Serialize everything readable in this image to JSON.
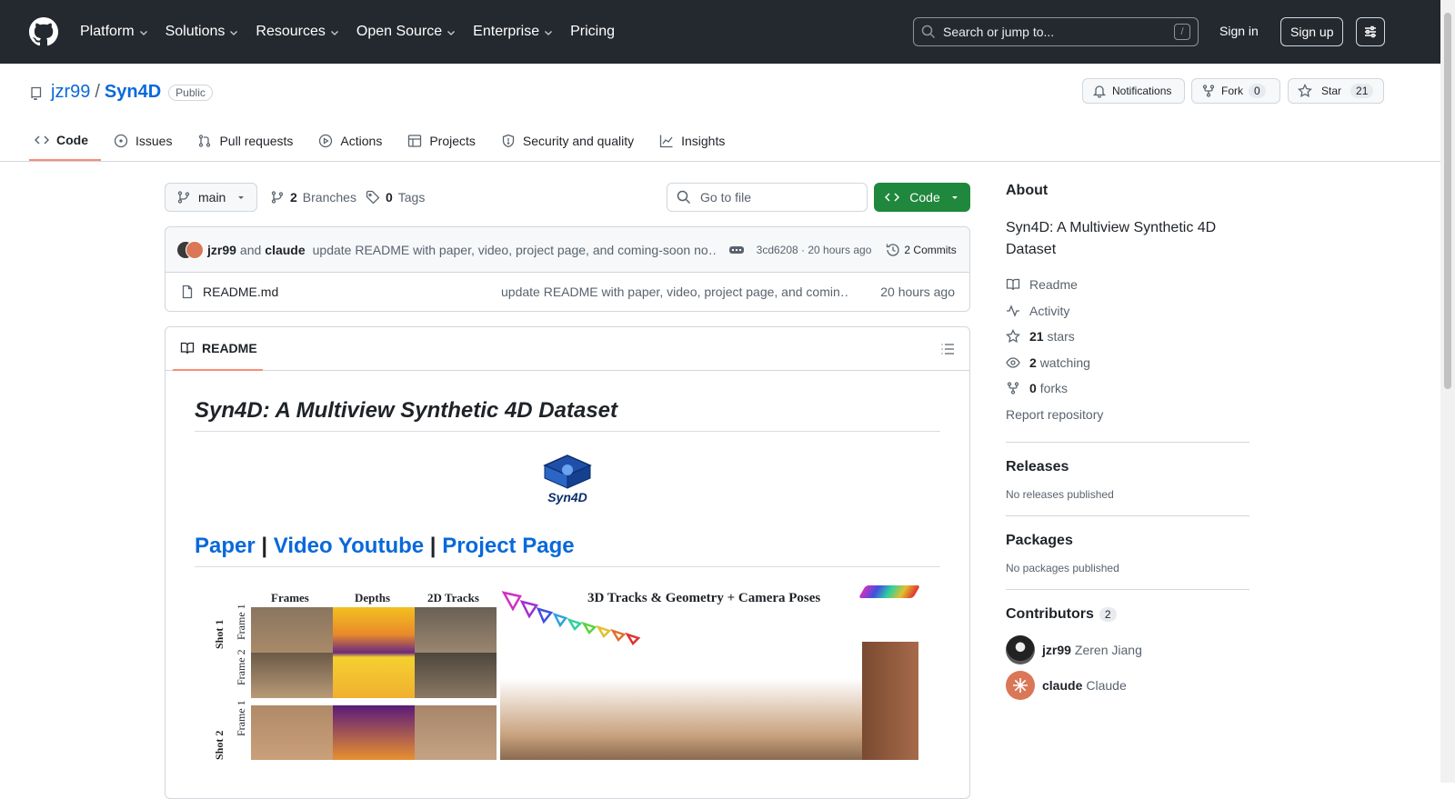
{
  "header": {
    "nav": [
      "Platform",
      "Solutions",
      "Resources",
      "Open Source",
      "Enterprise",
      "Pricing"
    ],
    "search_placeholder": "Search or jump to...",
    "slash": "/",
    "signin": "Sign in",
    "signup": "Sign up"
  },
  "repo": {
    "owner": "jzr99",
    "sep": "/",
    "name": "Syn4D",
    "visibility": "Public",
    "notifications": "Notifications",
    "fork": "Fork",
    "fork_count": "0",
    "star": "Star",
    "star_count": "21"
  },
  "tabs": [
    "Code",
    "Issues",
    "Pull requests",
    "Actions",
    "Projects",
    "Security and quality",
    "Insights"
  ],
  "bar": {
    "branch": "main",
    "branches_count": "2",
    "branches_label": "Branches",
    "tags_count": "0",
    "tags_label": "Tags",
    "gofile": "Go to file",
    "code": "Code"
  },
  "commit": {
    "author1": "jzr99",
    "and": "and",
    "author2": "claude",
    "message": "update README with paper, video, project page, and coming-soon no…",
    "hash": "3cd6208 · 20 hours ago",
    "commits": "2 Commits"
  },
  "files": [
    {
      "name": "README.md",
      "message": "update README with paper, video, project page, and comin…",
      "time": "20 hours ago"
    }
  ],
  "readme": {
    "tab": "README",
    "title": "Syn4D: A Multiview Synthetic 4D Dataset",
    "logo_text": "Syn4D",
    "link1": "Paper",
    "bar": "|",
    "link2": "Video Youtube",
    "link3": "Project Page",
    "fig_frames": "Frames",
    "fig_depths": "Depths",
    "fig_tracks": "2D Tracks",
    "fig_right": "3D Tracks & Geometry + Camera Poses",
    "shot1": "Shot 1",
    "shot2": "Shot 2",
    "frame1": "Frame 1",
    "frame2": "Frame 2"
  },
  "about": {
    "title": "About",
    "desc": "Syn4D: A Multiview Synthetic 4D Dataset",
    "readme": "Readme",
    "activity": "Activity",
    "stars_n": "21",
    "stars": "stars",
    "watching_n": "2",
    "watching": "watching",
    "forks_n": "0",
    "forks": "forks",
    "report": "Report repository"
  },
  "releases": {
    "title": "Releases",
    "none": "No releases published"
  },
  "packages": {
    "title": "Packages",
    "none": "No packages published"
  },
  "contributors": {
    "title": "Contributors",
    "count": "2",
    "list": [
      {
        "login": "jzr99",
        "name": "Zeren Jiang"
      },
      {
        "login": "claude",
        "name": "Claude"
      }
    ]
  }
}
